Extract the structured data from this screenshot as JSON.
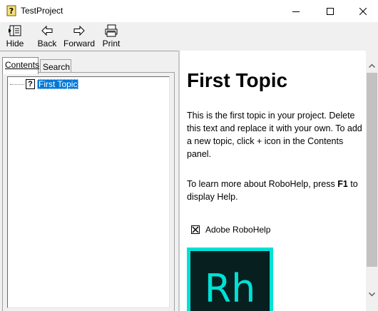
{
  "window": {
    "title": "TestProject",
    "icon": "help-book-icon"
  },
  "toolbar": {
    "hide_label": "Hide",
    "back_label": "Back",
    "forward_label": "Forward",
    "print_label": "Print"
  },
  "nav_tabs": {
    "contents_label": "Contents",
    "search_label": "Search"
  },
  "tree": {
    "items": [
      {
        "label": "First Topic",
        "icon": "topic-question-icon",
        "selected": true
      }
    ]
  },
  "topic": {
    "title": "First Topic",
    "paragraph1": "This is the first topic in your project. Delete this text and replace it with your own. To add a new topic, click + icon in the Contents panel.",
    "paragraph2_prefix": "To learn more about RoboHelp, press ",
    "paragraph2_key": "F1",
    "paragraph2_suffix": " to display Help.",
    "image_caption": "Adobe RoboHelp",
    "logo_text": "Rh"
  },
  "colors": {
    "selection": "#0078d7",
    "logo_accent": "#00e1d6",
    "logo_bg": "#07201f",
    "chrome": "#f0f0f0"
  }
}
